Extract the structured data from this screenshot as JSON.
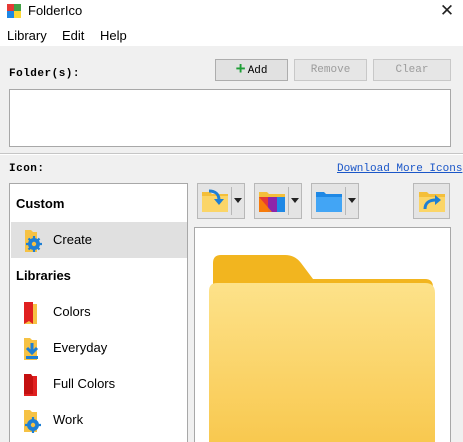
{
  "window": {
    "title": "FolderIco",
    "close_glyph": "✕"
  },
  "menu": [
    "Library",
    "Edit",
    "Help"
  ],
  "folders": {
    "label": "Folder(s):",
    "add_label": "Add",
    "remove_label": "Remove",
    "clear_label": "Clear"
  },
  "icon_section": {
    "label": "Icon:",
    "download_link": "Download More Icons"
  },
  "library": {
    "custom_header": "Custom",
    "libraries_header": "Libraries",
    "items": [
      {
        "label": "Create",
        "icon": "gear-folder-icon",
        "selected": true
      },
      {
        "label": "Colors",
        "icon": "red-folder-icon"
      },
      {
        "label": "Everyday",
        "icon": "download-folder-icon"
      },
      {
        "label": "Full Colors",
        "icon": "red-flag-folder-icon"
      },
      {
        "label": "Work",
        "icon": "gear-folder-icon"
      }
    ]
  },
  "toolbar": [
    "apply-folder-icon",
    "color-folder-icon",
    "blue-folder-icon",
    "export-folder-icon"
  ],
  "colors": {
    "accent_link": "#1a56c8",
    "add_plus": "#1e9e36",
    "folder": "#f8c74c"
  }
}
